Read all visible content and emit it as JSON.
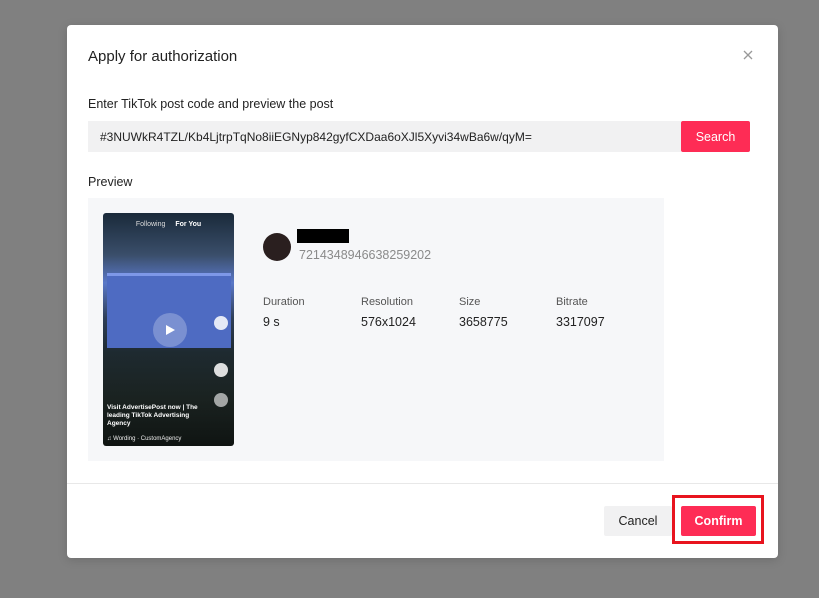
{
  "dialog": {
    "title": "Apply for authorization",
    "close_icon": "close-icon"
  },
  "post_code": {
    "label": "Enter TikTok post code and preview the post",
    "value": "#3NUWkR4TZL/Kb4LjtrpTqNo8iiEGNyp842gyfCXDaa6oXJl5Xyvi34wBa6w/qyM=",
    "search_label": "Search"
  },
  "preview": {
    "label": "Preview",
    "thumbnail": {
      "tab_following": "Following",
      "tab_for_you": "For You",
      "caption": "Visit AdvertisePost now | The leading TikTok Advertising Agency",
      "music": "♫ Wording · CustomAgency"
    },
    "user_id": "7214348946638259202",
    "stats": [
      {
        "label": "Duration",
        "value": "9 s"
      },
      {
        "label": "Resolution",
        "value": "576x1024"
      },
      {
        "label": "Size",
        "value": "3658775"
      },
      {
        "label": "Bitrate",
        "value": "3317097"
      }
    ]
  },
  "footer": {
    "cancel_label": "Cancel",
    "confirm_label": "Confirm"
  },
  "colors": {
    "accent": "#fe2c55",
    "highlight": "#e8141e",
    "backdrop": "#808080"
  }
}
